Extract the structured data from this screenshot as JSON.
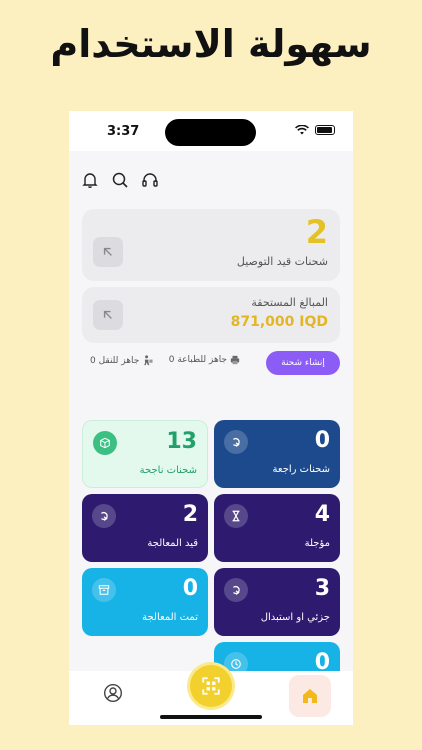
{
  "headline": "سهولة الاستخدام",
  "status_bar": {
    "time": "3:37"
  },
  "top_icons": [
    "bell-icon",
    "search-icon",
    "headset-icon"
  ],
  "summary_cards": {
    "in_delivery": {
      "count": "2",
      "label": "شحنات قيد التوصيل"
    },
    "due_amounts": {
      "label": "المبالغ المستحقة",
      "amount": "871,000 IQD"
    }
  },
  "quick_actions": {
    "create_label": "إنشاء شحنة",
    "ready_print": "جاهز للطباعة 0",
    "ready_transfer": "جاهز للنقل 0"
  },
  "tiles": [
    {
      "count": "0",
      "label": "شحنات راجعة",
      "color": "#1c4a8c",
      "icon": "return-arrow-icon"
    },
    {
      "count": "13",
      "label": "شحنات ناجحة",
      "color": "#e3f9ed",
      "icon": "box-icon"
    },
    {
      "count": "4",
      "label": "مؤجلة",
      "color": "#2e1a6e",
      "icon": "hourglass-icon"
    },
    {
      "count": "2",
      "label": "قيد المعالجة",
      "color": "#2e1a6e",
      "icon": "processing-icon"
    },
    {
      "count": "3",
      "label": "جزئي او استبدال",
      "color": "#2e1a6e",
      "icon": "exchange-icon"
    },
    {
      "count": "0",
      "label": "تمت المعالجة",
      "color": "#17b3e6",
      "icon": "archive-icon"
    },
    {
      "count": "0",
      "label": "",
      "color": "#17b3e6",
      "icon": "clock-icon"
    }
  ],
  "colors": {
    "accent_yellow": "#e4c224",
    "purple": "#8b5cf6",
    "success_green": "#22a06b",
    "background": "#fdf0c0"
  }
}
